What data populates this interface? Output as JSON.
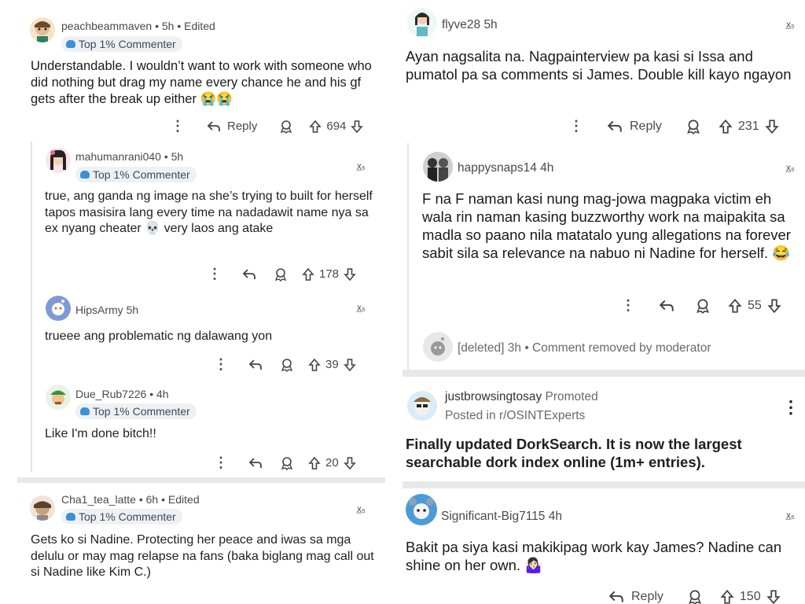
{
  "left": {
    "comments": [
      {
        "user": "peachbeammaven",
        "meta": "• 5h • Edited",
        "badge": "Top 1% Commenter",
        "body": "Understandable. I wouldn’t want to work with someone who did nothing but drag my name every chance he and his gf gets after the break up either 😭😭",
        "reply": "Reply",
        "votes": "694"
      },
      {
        "user": "mahumanrani040",
        "meta": "• 5h",
        "badge": "Top 1% Commenter",
        "body": "true, ang ganda ng image na she’s trying to built for herself tapos masisira lang every time na nadadawit name nya sa ex nyang cheater 💀 very laos ang atake",
        "votes": "178"
      },
      {
        "user": "HipsArmy",
        "meta": "5h",
        "body": "trueee ang problematic ng dalawang yon",
        "votes": "39"
      },
      {
        "user": "Due_Rub7226",
        "meta": "• 4h",
        "badge": "Top 1% Commenter",
        "body": "Like I'm done bitch!!",
        "votes": "20"
      },
      {
        "user": "Cha1_tea_latte",
        "meta": "• 6h • Edited",
        "badge": "Top 1% Commenter",
        "body": "Gets ko si Nadine. Protecting her peace and iwas sa mga delulu or may mag relapse na fans (baka biglang mag call out si Nadine like Kim C.)"
      }
    ]
  },
  "right": {
    "comments": [
      {
        "user": "flyve28",
        "meta": "5h",
        "body": "Ayan nagsalita na. Nagpainterview pa kasi si Issa and pumatol pa sa comments si James. Double kill kayo ngayon",
        "reply": "Reply",
        "votes": "231"
      },
      {
        "user": "happysnaps14",
        "meta": "4h",
        "body": "F na F naman kasi nung mag-jowa magpaka victim eh wala rin naman kasing buzzworthy work na maipakita sa madla so paano nila matatalo yung allegations na forever sabit sila sa relevance na nabuo ni Nadine for herself. 😂",
        "votes": "55"
      },
      {
        "user": "[deleted]",
        "meta": "3h • Comment removed by moderator"
      }
    ],
    "promo": {
      "user": "justbrowsingtosay",
      "tag": "Promoted",
      "sub": "Posted in r/OSINTExperts",
      "body": "Finally updated DorkSearch. It is now the largest searchable dork index online (1m+ entries)."
    },
    "last": {
      "user": "Significant-Big7115",
      "meta": "4h",
      "body": "Bakit pa siya kasi makikipag work kay James? Nadine can shine on her own. 🤷🏻‍♀️",
      "reply": "Reply",
      "votes": "150"
    }
  }
}
